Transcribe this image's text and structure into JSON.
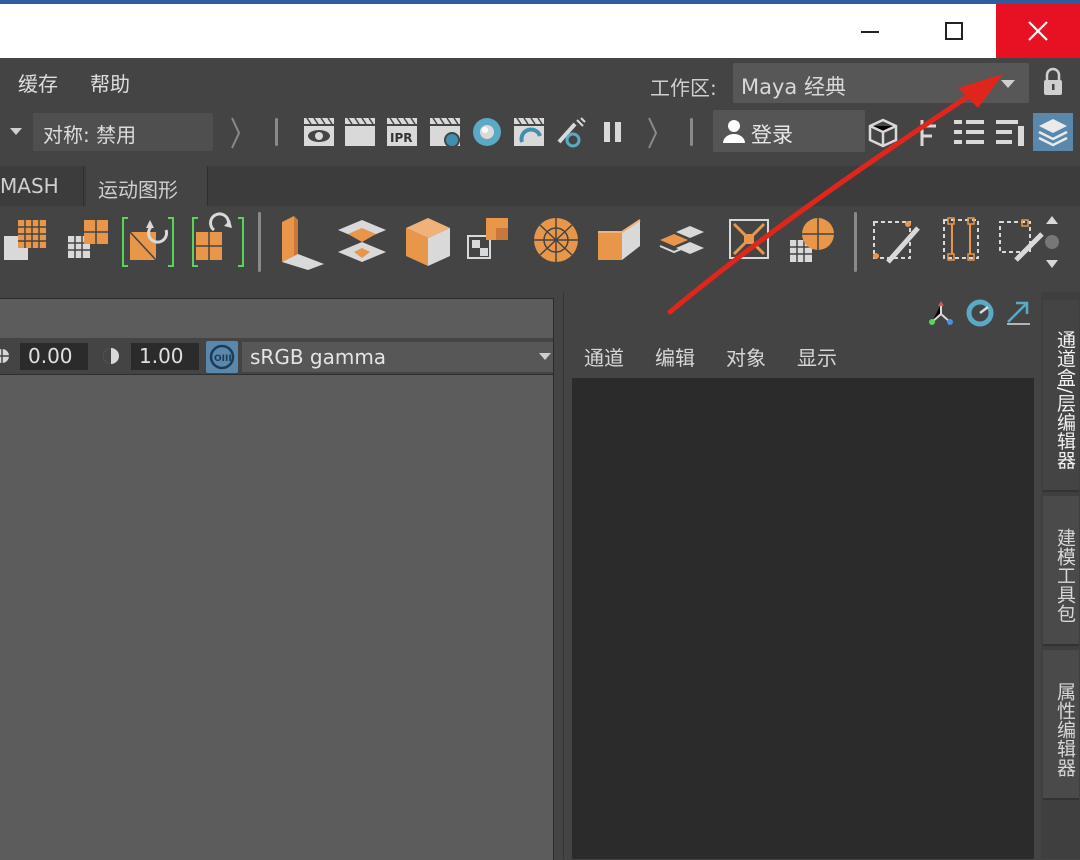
{
  "window": {
    "controls": [
      "minimize",
      "maximize",
      "close"
    ]
  },
  "menubar": {
    "items": [
      "缓存",
      "帮助"
    ],
    "workspace_label": "工作区:",
    "workspace_value": "Maya 经典"
  },
  "statusline": {
    "symmetry": "对称: 禁用",
    "login": "登录"
  },
  "shelf": {
    "tabs": [
      "MASH",
      "运动图形"
    ]
  },
  "color_management": {
    "exposure": "0.00",
    "gamma": "1.00",
    "view_transform": "sRGB gamma"
  },
  "channel_box": {
    "menus": [
      "通道",
      "编辑",
      "对象",
      "显示"
    ]
  },
  "side_tabs": [
    "通道盒/层编辑器",
    "建模工具包",
    "属性编辑器"
  ],
  "colors": {
    "close_button": "#e81123",
    "annotation_arrow": "#e0261c",
    "shelf_icon_orange": "#e8964a",
    "channel_list_bg": "#2b2b2b"
  }
}
